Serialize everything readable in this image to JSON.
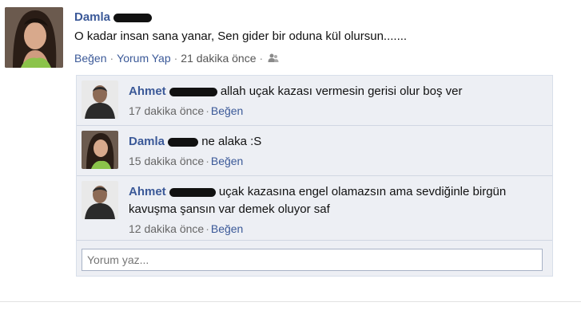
{
  "post": {
    "author": "Damla",
    "text": "O kadar insan sana yanar, Sen gider bir oduna kül olursun.......",
    "actions": {
      "like": "Beğen",
      "comment": "Yorum Yap",
      "time": "21 dakika önce",
      "audience_icon": "friends-icon"
    }
  },
  "comments": [
    {
      "author": "Ahmet",
      "text": "allah uçak kazası vermesin gerisi olur boş ver",
      "time": "17 dakika önce",
      "like": "Beğen"
    },
    {
      "author": "Damla",
      "text": "ne alaka :S",
      "time": "15 dakika önce",
      "like": "Beğen"
    },
    {
      "author": "Ahmet",
      "text": "uçak kazasına engel olamazsın ama sevdiğinle birgün kavuşma şansın var demek oluyor saf",
      "time": "12 dakika önce",
      "like": "Beğen"
    }
  ],
  "comment_box": {
    "placeholder": "Yorum yaz..."
  },
  "colors": {
    "link": "#3b5998",
    "comment_bg": "#edeff4",
    "border": "#d8dfea"
  }
}
